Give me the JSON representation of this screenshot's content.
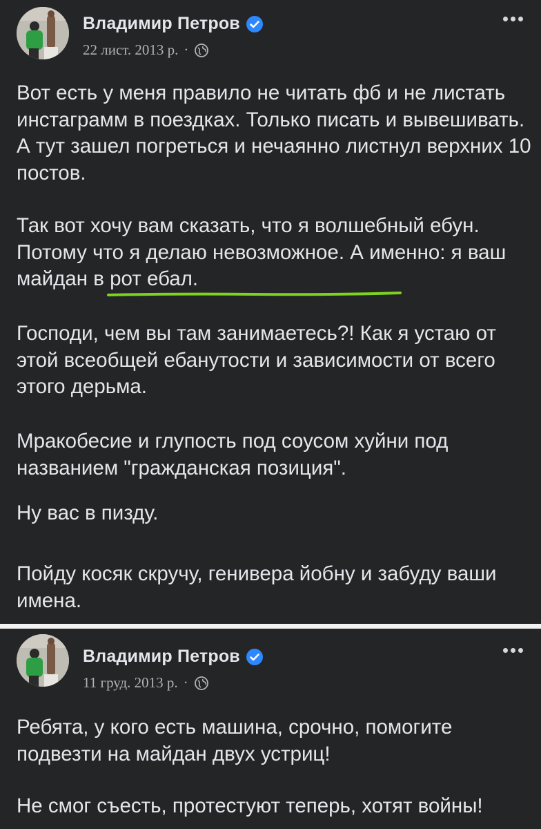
{
  "posts": [
    {
      "author": "Владимир Петров",
      "date": "22 лист. 2013 р.",
      "separator": "·",
      "paragraphs": [
        "Вот есть у меня правило не читать фб и не листать инстаграмм в поездках. Только писать и вывешивать. А тут зашел погреться и нечаянно листнул верхних 10 постов.",
        "Так вот хочу вам сказать, что я волшебный ебун. Потому что я делаю невозможное. А именно: я ваш майдан в рот ебал.",
        "Господи, чем вы там занимаетесь?! Как я устаю от этой всеобщей ебанутости и зависимости от всего этого дерьма.",
        "Мракобесие и глупость под соусом хуйни под названием \"гражданская позиция\".",
        "Ну вас в пизду.",
        "Пойду косяк скручу, генивера йобну и забуду ваши имена."
      ]
    },
    {
      "author": "Владимир Петров",
      "date": "11 груд. 2013 р.",
      "separator": "·",
      "paragraphs": [
        "Ребята, у кого есть машина, срочно, помогите подвезти на майдан двух устриц!",
        "Не смог съесть, протестуют теперь, хотят войны!"
      ]
    }
  ],
  "colors": {
    "background": "#242526",
    "text": "#e4e6eb",
    "secondary_text": "#b0b3b8",
    "verified_badge": "#2d88ff",
    "highlight_underline": "#7ed321",
    "divider": "#f2f2f2"
  },
  "icons": {
    "verified": "verified-badge-icon",
    "privacy": "globe-icon",
    "more": "more-options-icon"
  }
}
